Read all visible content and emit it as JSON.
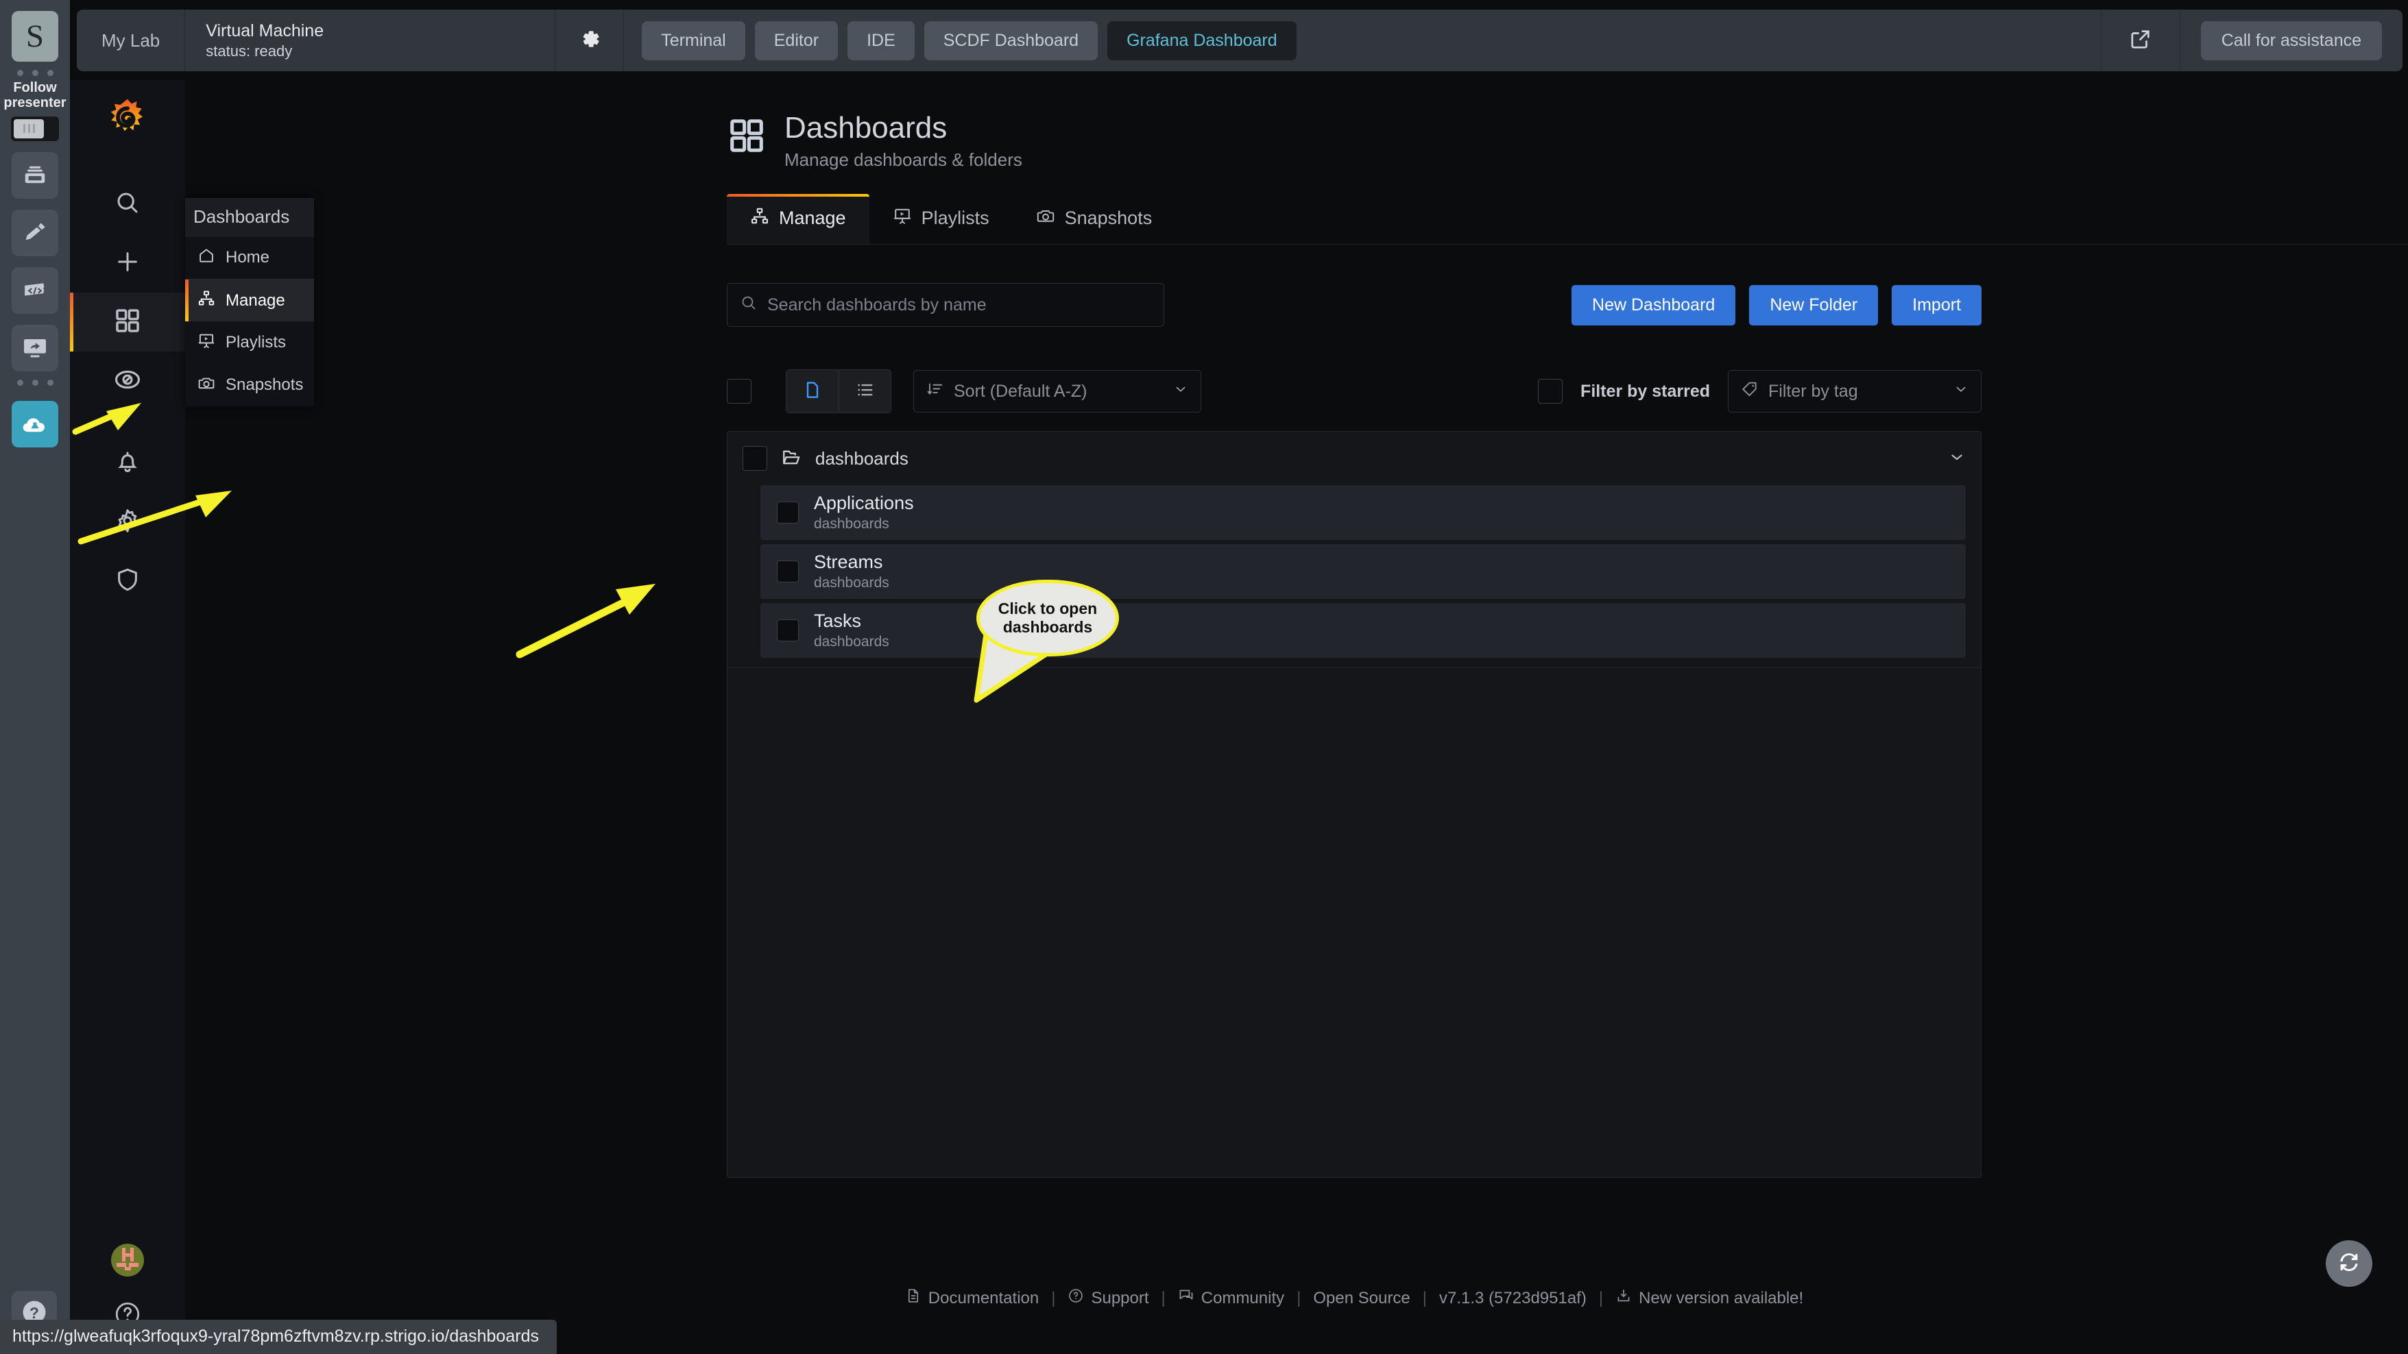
{
  "lab": {
    "brand_letter": "S",
    "follow_label": "Follow\npresenter",
    "my_lab": "My Lab",
    "vm_title": "Virtual Machine",
    "vm_status": "status: ready",
    "tabs": [
      {
        "label": "Terminal",
        "active": false
      },
      {
        "label": "Editor",
        "active": false
      },
      {
        "label": "IDE",
        "active": false
      },
      {
        "label": "SCDF Dashboard",
        "active": false
      },
      {
        "label": "Grafana Dashboard",
        "active": true
      }
    ],
    "assistance_label": "Call for assistance",
    "accent_active": "#5ec0d6"
  },
  "sidemenu": {
    "items": [
      {
        "name": "search",
        "label": "Search"
      },
      {
        "name": "add",
        "label": "Create"
      },
      {
        "name": "dashboards",
        "label": "Dashboards",
        "active": true
      },
      {
        "name": "explore",
        "label": "Explore"
      },
      {
        "name": "alerting",
        "label": "Alerting"
      },
      {
        "name": "configuration",
        "label": "Configuration"
      },
      {
        "name": "shield",
        "label": "Server Admin"
      }
    ]
  },
  "dropdown": {
    "header": "Dashboards",
    "items": [
      {
        "label": "Home",
        "icon": "home-icon",
        "active": false,
        "sep": false
      },
      {
        "label": "Manage",
        "icon": "sitemap-icon",
        "active": true,
        "sep": true
      },
      {
        "label": "Playlists",
        "icon": "presentation-icon",
        "active": false,
        "sep": false
      },
      {
        "label": "Snapshots",
        "icon": "camera-icon",
        "active": false,
        "sep": false
      }
    ]
  },
  "page": {
    "title": "Dashboards",
    "subtitle": "Manage dashboards & folders",
    "tabs": [
      {
        "label": "Manage",
        "icon": "sitemap-icon",
        "active": true
      },
      {
        "label": "Playlists",
        "icon": "presentation-icon",
        "active": false
      },
      {
        "label": "Snapshots",
        "icon": "camera-icon",
        "active": false
      }
    ]
  },
  "search": {
    "placeholder": "Search dashboards by name",
    "value": ""
  },
  "actions": {
    "new_dashboard": "New Dashboard",
    "new_folder": "New Folder",
    "import": "Import",
    "primary_color": "#3274d9"
  },
  "filters": {
    "sort_label": "Sort (Default A-Z)",
    "starred_label": "Filter by starred",
    "tag_placeholder": "Filter by tag",
    "view_folders_active": true
  },
  "results": {
    "folder": {
      "name": "dashboards",
      "checked": false,
      "expanded": true
    },
    "items": [
      {
        "title": "Applications",
        "folder": "dashboards",
        "checked": false
      },
      {
        "title": "Streams",
        "folder": "dashboards",
        "checked": false
      },
      {
        "title": "Tasks",
        "folder": "dashboards",
        "checked": false
      }
    ]
  },
  "footer": {
    "links": [
      {
        "label": "Documentation",
        "icon": "document-icon"
      },
      {
        "label": "Support",
        "icon": "question-circle-icon"
      },
      {
        "label": "Community",
        "icon": "comments-icon"
      },
      {
        "label": "Open Source",
        "icon": null
      }
    ],
    "version": "v7.1.3 (5723d951af)",
    "update": "New version available!"
  },
  "annotation": {
    "callout_text": "Click to open dashboards",
    "color": "#f5f12a"
  },
  "status_url": "https://glweafuqk3rfoqux9-yral78pm6zftvm8zv.rp.strigo.io/dashboards"
}
